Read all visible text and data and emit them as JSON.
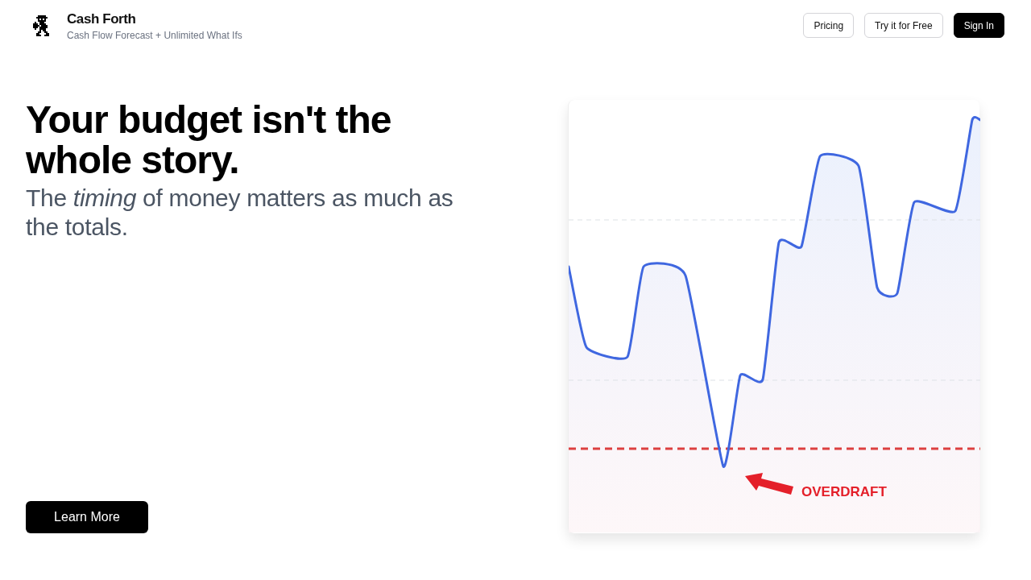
{
  "header": {
    "brand": {
      "name": "Cash Forth",
      "tagline": "Cash Flow Forecast + Unlimited What Ifs"
    },
    "nav_buttons": [
      {
        "label": "Pricing",
        "kind": "outline"
      },
      {
        "label": "Try it for Free",
        "kind": "outline"
      },
      {
        "label": "Sign In",
        "kind": "solid"
      }
    ]
  },
  "hero": {
    "headline": "Your budget isn't the whole story.",
    "subheadline": "The *timing* of money matters as much as the totals.",
    "cta": "Learn More"
  },
  "illustration": {
    "annotation": "OVERDRAFT"
  }
}
